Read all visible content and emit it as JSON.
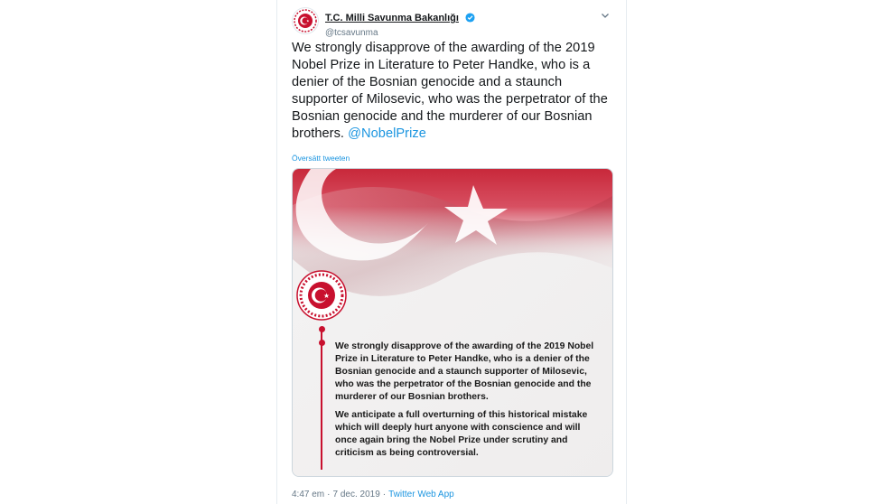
{
  "account": {
    "display_name": "T.C. Milli Savunma Bakanlığı",
    "handle": "@tcsavunma",
    "verified_icon": "verified-badge-icon"
  },
  "tweet": {
    "text": "We strongly disapprove of the awarding of the 2019 Nobel Prize in Literature to Peter Handke, who is a denier of the Bosnian genocide and a staunch supporter of Milosevic, who was the perpetrator of the Bosnian genocide and the murderer of our Bosnian brothers.",
    "mention": "@NobelPrize",
    "translate_label": "Översätt tweeten"
  },
  "media": {
    "paragraph_1": "We strongly disapprove of the awarding of the 2019 Nobel Prize in Literature to Peter Handke, who is a denier of the Bosnian genocide and a staunch supporter of Milosevic, who was the perpetrator of the Bosnian genocide and the murderer of our Bosnian brothers.",
    "paragraph_2": "We anticipate a full overturning of this historical mistake which will deeply hurt anyone with conscience and will once again bring the Nobel Prize under scrutiny and criticism as being controversial."
  },
  "footer": {
    "time": "4:47 em",
    "separator": "·",
    "date": "7 dec. 2019",
    "source": "Twitter Web App"
  },
  "colors": {
    "accent": "#1b95e0",
    "flag_red": "#c8102e",
    "verified_blue": "#1da1f2"
  }
}
